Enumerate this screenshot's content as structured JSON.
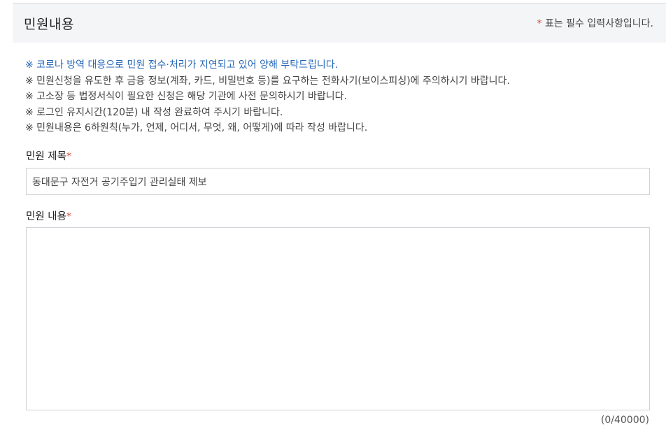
{
  "header": {
    "title": "민원내용",
    "required_star": "*",
    "required_text": " 표는 필수 입력사항입니다."
  },
  "notices": [
    "※ 코로나 방역 대응으로 민원 접수·처리가 지연되고 있어 양해 부탁드립니다.",
    "※ 민원신청을 유도한 후 금융 정보(계좌, 카드, 비밀번호 등)를 요구하는 전화사기(보이스피싱)에 주의하시기 바랍니다.",
    "※ 고소장 등 법정서식이 필요한 신청은 해당 기관에 사전 문의하시기 바랍니다.",
    "※ 로그인 유지시간(120분) 내 작성 완료하여 주시기 바랍니다.",
    "※ 민원내용은 6하원칙(누가, 언제, 어디서, 무엇, 왜, 어떻게)에 따라 작성 바랍니다."
  ],
  "form": {
    "title_label": "민원 제목",
    "title_value": "동대문구 자전거 공기주입기 관리실태 제보",
    "content_label": "민원 내용",
    "content_value": "",
    "required_star": "*",
    "char_count": "(0/40000)"
  },
  "colors": {
    "notice_highlight": "#2366b8",
    "required_star": "#d64b3a",
    "header_bg": "#f4f5f7"
  }
}
